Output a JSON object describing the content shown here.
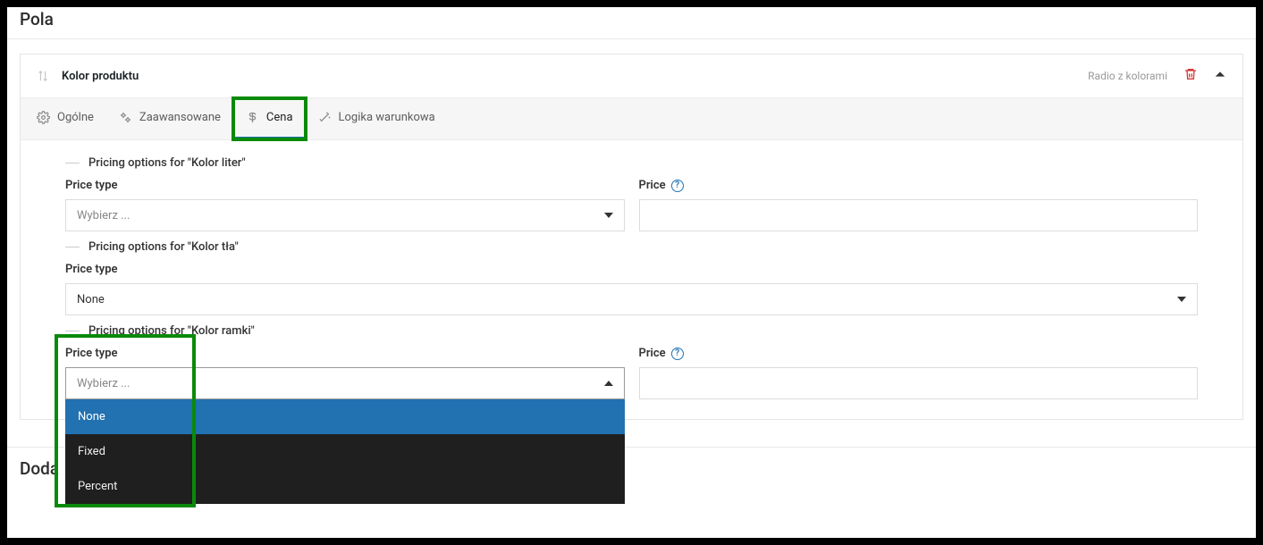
{
  "page": {
    "title": "Pola",
    "addSection": "Doda"
  },
  "field": {
    "title": "Kolor produktu",
    "typeBadge": "Radio z kolorami"
  },
  "tabs": {
    "general": "Ogólne",
    "advanced": "Zaawansowane",
    "price": "Cena",
    "logic": "Logika warunkowa"
  },
  "labels": {
    "priceType": "Price type",
    "price": "Price",
    "choose": "Wybierz ..."
  },
  "sections": {
    "s1": "Pricing options for \"Kolor liter\"",
    "s2": "Pricing options for \"Kolor tła\"",
    "s3": "Pricing options for \"Kolor ramki\""
  },
  "values": {
    "s2priceType": "None"
  },
  "dropdown": {
    "opt1": "None",
    "opt2": "Fixed",
    "opt3": "Percent"
  }
}
